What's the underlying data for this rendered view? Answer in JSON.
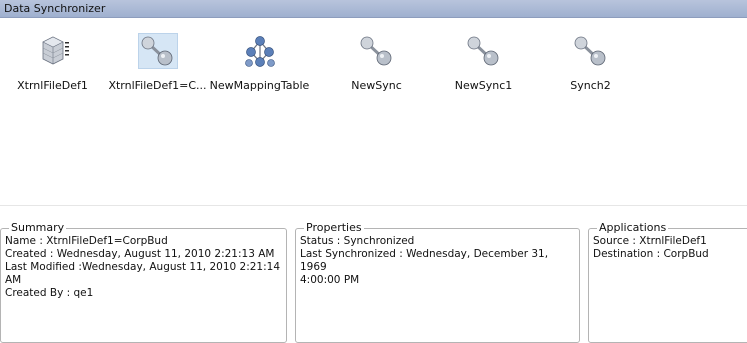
{
  "window": {
    "title": "Data Synchronizer"
  },
  "items": [
    {
      "label": "XtrnlFileDef1",
      "icon": "file-definition-icon"
    },
    {
      "label": "XtrnlFileDef1=C...",
      "icon": "sync-icon",
      "selected": true
    },
    {
      "label": "NewMappingTable",
      "icon": "mapping-table-icon"
    },
    {
      "label": "NewSync",
      "icon": "sync-icon"
    },
    {
      "label": "NewSync1",
      "icon": "sync-icon"
    },
    {
      "label": "Synch2",
      "icon": "sync-icon"
    }
  ],
  "summary": {
    "title": "Summary",
    "name": "Name : XtrnlFileDef1=CorpBud",
    "created": "Created : Wednesday, August 11, 2010 2:21:13 AM",
    "last_modified_1": "Last Modified :Wednesday, August 11, 2010 2:21:14",
    "last_modified_2": "AM",
    "created_by": "Created By : qe1"
  },
  "properties": {
    "title": "Properties",
    "status": "Status : Synchronized",
    "last_sync_1": "Last Synchronized : Wednesday, December 31, 1969",
    "last_sync_2": "4:00:00 PM"
  },
  "applications": {
    "title": "Applications",
    "source": "Source : XtrnlFileDef1",
    "destination": "Destination : CorpBud"
  },
  "colors": {
    "titlebar": "#a9b8d6",
    "icon_silver": "#9aa3ad",
    "icon_blue": "#5b7fb8",
    "selected_bg": "#d6e6f5"
  }
}
